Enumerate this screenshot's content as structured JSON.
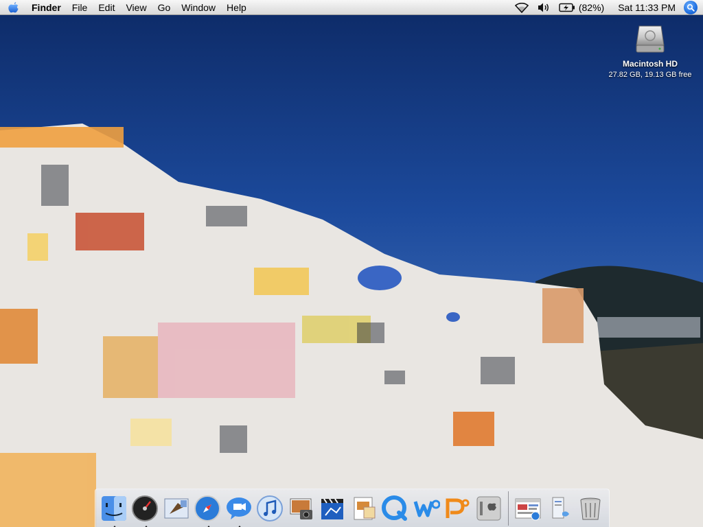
{
  "menubar": {
    "app_name": "Finder",
    "menus": [
      "File",
      "Edit",
      "View",
      "Go",
      "Window",
      "Help"
    ],
    "status": {
      "battery_percent": "(82%)",
      "clock": "Sat 11:33 PM"
    }
  },
  "desktop": {
    "hd_icon": {
      "name": "Macintosh HD",
      "info": "27.82 GB, 19.13 GB free"
    }
  },
  "dock": {
    "apps": [
      {
        "id": "finder",
        "icon": "finder-icon",
        "running": true
      },
      {
        "id": "dashboard",
        "icon": "dashboard-icon",
        "running": true
      },
      {
        "id": "mail",
        "icon": "mail-icon",
        "running": false
      },
      {
        "id": "safari",
        "icon": "safari-icon",
        "running": true
      },
      {
        "id": "ichat",
        "icon": "ichat-icon",
        "running": true
      },
      {
        "id": "itunes",
        "icon": "itunes-icon",
        "running": false
      },
      {
        "id": "iphoto",
        "icon": "iphoto-icon",
        "running": false
      },
      {
        "id": "imovie",
        "icon": "imovie-icon",
        "running": false
      },
      {
        "id": "preview",
        "icon": "preview-icon",
        "running": false
      },
      {
        "id": "quicktime",
        "icon": "quicktime-icon",
        "running": false
      },
      {
        "id": "word",
        "icon": "word-icon",
        "running": false
      },
      {
        "id": "powerpoint",
        "icon": "powerpoint-icon",
        "running": false
      },
      {
        "id": "system-preferences",
        "icon": "system-preferences-icon",
        "running": false
      }
    ],
    "docs": [
      {
        "id": "minimized-window",
        "icon": "minimized-window-icon"
      },
      {
        "id": "documents",
        "icon": "documents-stack-icon"
      },
      {
        "id": "trash",
        "icon": "trash-icon"
      }
    ]
  }
}
